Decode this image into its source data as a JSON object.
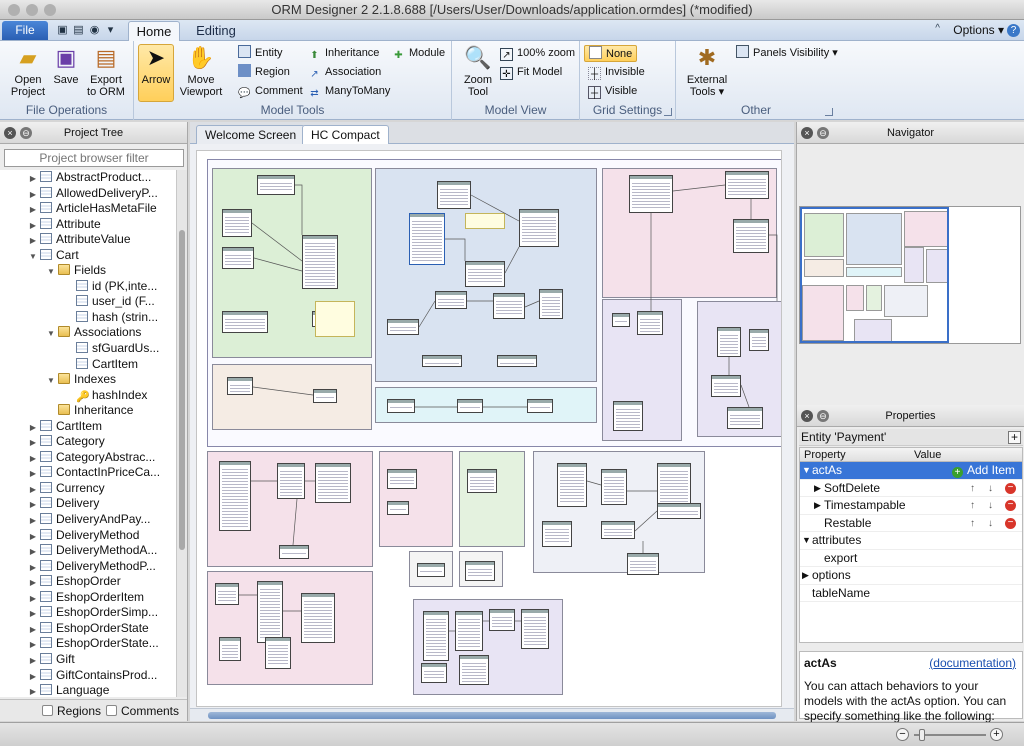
{
  "window": {
    "title": "ORM Designer 2 2.1.8.688 [/Users/User/Downloads/application.ormdes] (*modified)"
  },
  "ribbon": {
    "file_tab": "File",
    "tabs": [
      "Home",
      "Editing"
    ],
    "options": "Options ▾",
    "help": "?",
    "collapse": "^",
    "groups": {
      "file_operations": {
        "label": "File Operations",
        "buttons": [
          "Open\nProject",
          "Save",
          "Export\nto ORM"
        ]
      },
      "model_tools": {
        "label": "Model Tools",
        "arrow": "Arrow",
        "move_viewport": "Move\nViewport",
        "entity": "Entity",
        "region": "Region",
        "comment": "Comment",
        "inheritance": "Inheritance",
        "association": "Association",
        "many_to_many": "ManyToMany",
        "module": "Module"
      },
      "model_view": {
        "label": "Model View",
        "zoom_tool": "Zoom\nTool",
        "zoom_100": "100% zoom",
        "fit_model": "Fit Model"
      },
      "grid_settings": {
        "label": "Grid Settings",
        "none": "None",
        "invisible": "Invisible",
        "visible": "Visible"
      },
      "other": {
        "label": "Other",
        "external_tools": "External\nTools ▾",
        "panels_visibility": "Panels Visibility ▾"
      }
    }
  },
  "project_tree": {
    "title": "Project Tree",
    "filter_placeholder": "Project browser filter",
    "items": [
      {
        "label": "AbstractProduct...",
        "level": 0,
        "arrow": "▶",
        "icon": "entity"
      },
      {
        "label": "AllowedDeliveryP...",
        "level": 0,
        "arrow": "▶",
        "icon": "entity"
      },
      {
        "label": "ArticleHasMetaFile",
        "level": 0,
        "arrow": "▶",
        "icon": "entity"
      },
      {
        "label": "Attribute",
        "level": 0,
        "arrow": "▶",
        "icon": "entity"
      },
      {
        "label": "AttributeValue",
        "level": 0,
        "arrow": "▶",
        "icon": "entity"
      },
      {
        "label": "Cart",
        "level": 0,
        "arrow": "▼",
        "icon": "entity"
      },
      {
        "label": "Fields",
        "level": 1,
        "arrow": "▼",
        "icon": "folder"
      },
      {
        "label": "id (PK,inte...",
        "level": 2,
        "arrow": "",
        "icon": "field"
      },
      {
        "label": "user_id (F...",
        "level": 2,
        "arrow": "",
        "icon": "field"
      },
      {
        "label": "hash (strin...",
        "level": 2,
        "arrow": "",
        "icon": "field"
      },
      {
        "label": "Associations",
        "level": 1,
        "arrow": "▼",
        "icon": "folder"
      },
      {
        "label": "sfGuardUs...",
        "level": 2,
        "arrow": "",
        "icon": "field"
      },
      {
        "label": "CartItem",
        "level": 2,
        "arrow": "",
        "icon": "field"
      },
      {
        "label": "Indexes",
        "level": 1,
        "arrow": "▼",
        "icon": "folder"
      },
      {
        "label": "hashIndex",
        "level": 2,
        "arrow": "",
        "icon": "key"
      },
      {
        "label": "Inheritance",
        "level": 1,
        "arrow": "",
        "icon": "folder"
      },
      {
        "label": "CartItem",
        "level": 0,
        "arrow": "▶",
        "icon": "entity"
      },
      {
        "label": "Category",
        "level": 0,
        "arrow": "▶",
        "icon": "entity"
      },
      {
        "label": "CategoryAbstrac...",
        "level": 0,
        "arrow": "▶",
        "icon": "entity"
      },
      {
        "label": "ContactInPriceCa...",
        "level": 0,
        "arrow": "▶",
        "icon": "entity"
      },
      {
        "label": "Currency",
        "level": 0,
        "arrow": "▶",
        "icon": "entity"
      },
      {
        "label": "Delivery",
        "level": 0,
        "arrow": "▶",
        "icon": "entity"
      },
      {
        "label": "DeliveryAndPay...",
        "level": 0,
        "arrow": "▶",
        "icon": "entity"
      },
      {
        "label": "DeliveryMethod",
        "level": 0,
        "arrow": "▶",
        "icon": "entity"
      },
      {
        "label": "DeliveryMethodA...",
        "level": 0,
        "arrow": "▶",
        "icon": "entity"
      },
      {
        "label": "DeliveryMethodP...",
        "level": 0,
        "arrow": "▶",
        "icon": "entity"
      },
      {
        "label": "EshopOrder",
        "level": 0,
        "arrow": "▶",
        "icon": "entity"
      },
      {
        "label": "EshopOrderItem",
        "level": 0,
        "arrow": "▶",
        "icon": "entity"
      },
      {
        "label": "EshopOrderSimp...",
        "level": 0,
        "arrow": "▶",
        "icon": "entity"
      },
      {
        "label": "EshopOrderState",
        "level": 0,
        "arrow": "▶",
        "icon": "entity"
      },
      {
        "label": "EshopOrderState...",
        "level": 0,
        "arrow": "▶",
        "icon": "entity"
      },
      {
        "label": "Gift",
        "level": 0,
        "arrow": "▶",
        "icon": "entity"
      },
      {
        "label": "GiftContainsProd...",
        "level": 0,
        "arrow": "▶",
        "icon": "entity"
      },
      {
        "label": "Language",
        "level": 0,
        "arrow": "▶",
        "icon": "entity"
      }
    ],
    "regions_label": "Regions",
    "comments_label": "Comments"
  },
  "document_tabs": [
    "Welcome Screen",
    "HC Compact"
  ],
  "navigator": {
    "title": "Navigator"
  },
  "properties": {
    "title": "Properties",
    "entity": "Entity 'Payment'",
    "col_property": "Property",
    "col_value": "Value",
    "rows": [
      {
        "name": "actAs",
        "arrow": "▼",
        "value": "Add Item",
        "selected": true,
        "indent": 0
      },
      {
        "name": "SoftDelete",
        "arrow": "▶",
        "value": "",
        "selected": false,
        "indent": 1
      },
      {
        "name": "Timestampable",
        "arrow": "▶",
        "value": "",
        "selected": false,
        "indent": 1
      },
      {
        "name": "Restable",
        "arrow": "",
        "value": "",
        "selected": false,
        "indent": 1
      },
      {
        "name": "attributes",
        "arrow": "▼",
        "value": "",
        "selected": false,
        "indent": 0
      },
      {
        "name": "export",
        "arrow": "",
        "value": "",
        "selected": false,
        "indent": 1
      },
      {
        "name": "options",
        "arrow": "▶",
        "value": "",
        "selected": false,
        "indent": 0
      },
      {
        "name": "tableName",
        "arrow": "",
        "value": "",
        "selected": false,
        "indent": 0
      }
    ],
    "desc_title": "actAs",
    "desc_link": "documentation",
    "desc_text": "You can attach behaviors to your models with the actAs option. You can specify something like the following:"
  },
  "colors": {
    "accent": "#3875d7",
    "region_green": "#dcefd6",
    "region_blue": "#d9e3f1",
    "region_pink": "#f5e1ea",
    "region_lavender": "#e8e4f4",
    "region_yellow": "#f7f3da",
    "region_cyan": "#e0f4f8"
  }
}
